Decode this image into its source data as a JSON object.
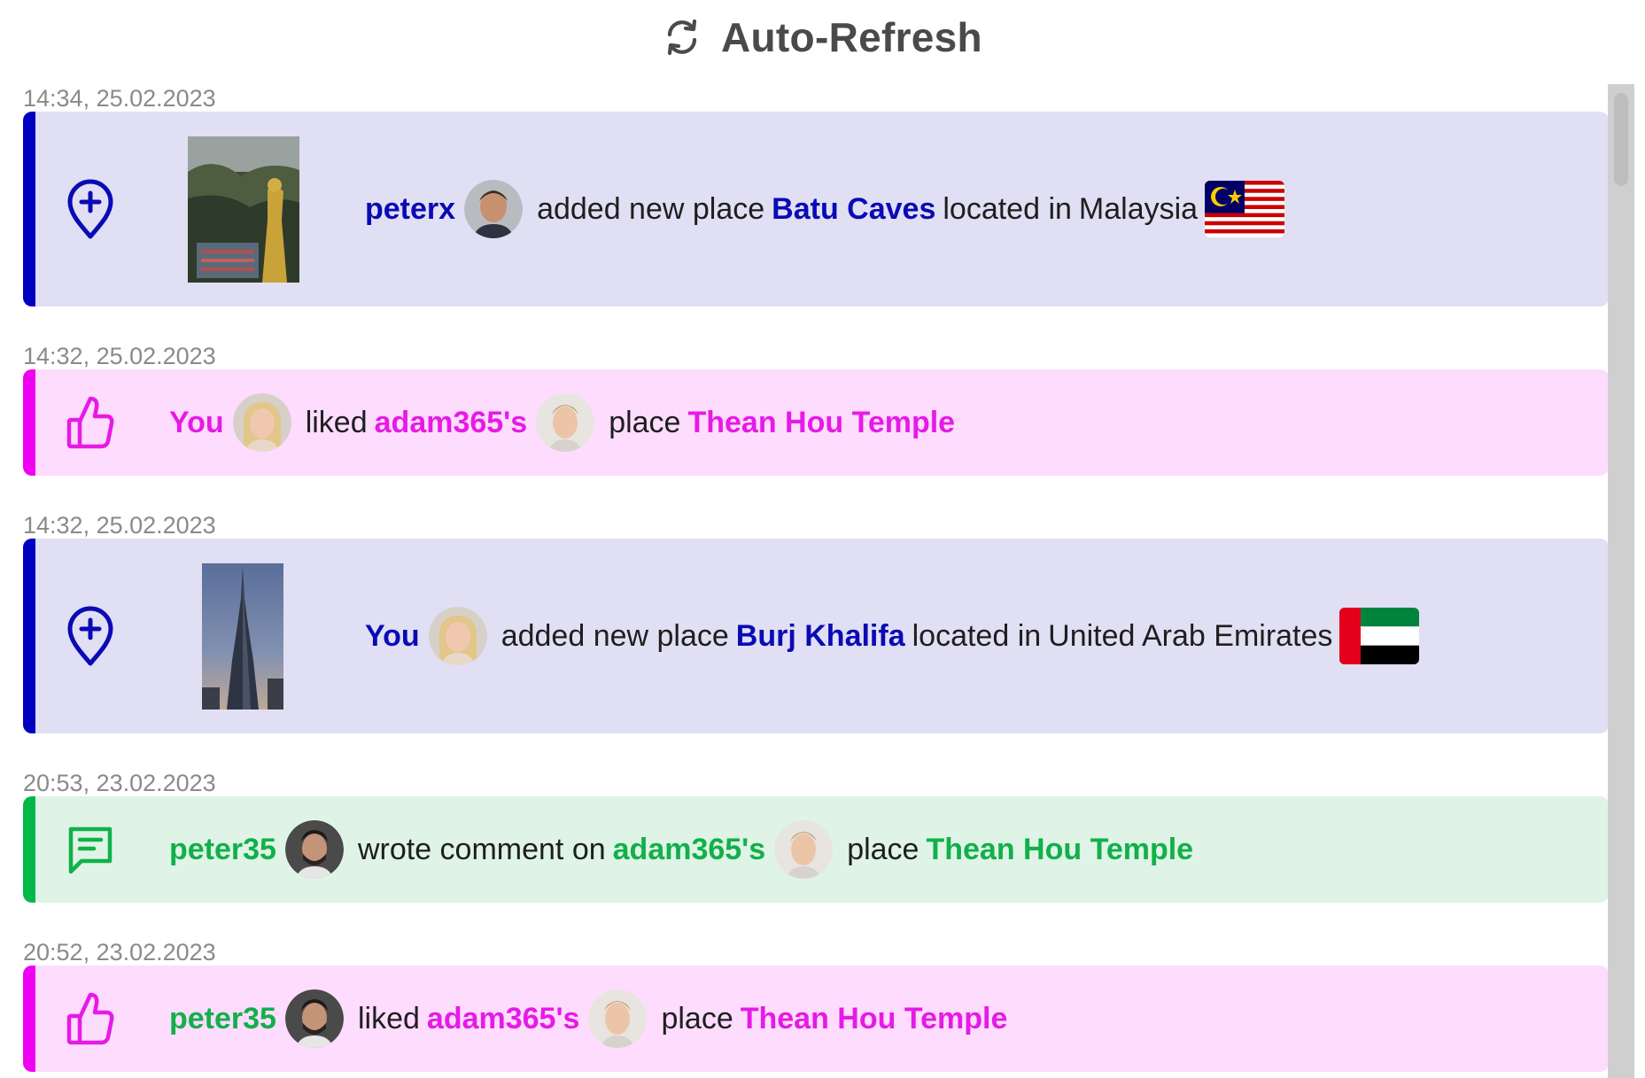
{
  "header": {
    "title": "Auto-Refresh",
    "icon": "refresh-icon"
  },
  "colors": {
    "added": "#0000c0",
    "liked": "#f000f0",
    "comment": "#00b84a"
  },
  "feed": [
    {
      "type": "added_place",
      "timestamp": "14:34, 25.02.2023",
      "actor": "peterx",
      "text1": "added new place",
      "place": "Batu Caves",
      "text2": "located in",
      "country": "Malaysia",
      "icon": "map-pin-plus-icon",
      "flag": "malaysia-flag"
    },
    {
      "type": "liked",
      "timestamp": "14:32, 25.02.2023",
      "actor": "You",
      "text1": "liked",
      "owner": "adam365's",
      "text2": "place",
      "place": "Thean Hou Temple",
      "icon": "thumbs-up-icon"
    },
    {
      "type": "added_place",
      "timestamp": "14:32, 25.02.2023",
      "actor": "You",
      "text1": "added new place",
      "place": "Burj Khalifa",
      "text2": "located in",
      "country": "United Arab Emirates",
      "icon": "map-pin-plus-icon",
      "flag": "uae-flag"
    },
    {
      "type": "comment",
      "timestamp": "20:53, 23.02.2023",
      "actor": "peter35",
      "text1": "wrote comment on",
      "owner": "adam365's",
      "text2": "place",
      "place": "Thean Hou Temple",
      "icon": "comment-icon"
    },
    {
      "type": "liked",
      "timestamp": "20:52, 23.02.2023",
      "actor": "peter35",
      "text1": "liked",
      "owner": "adam365's",
      "text2": "place",
      "place": "Thean Hou Temple",
      "icon": "thumbs-up-icon"
    }
  ]
}
